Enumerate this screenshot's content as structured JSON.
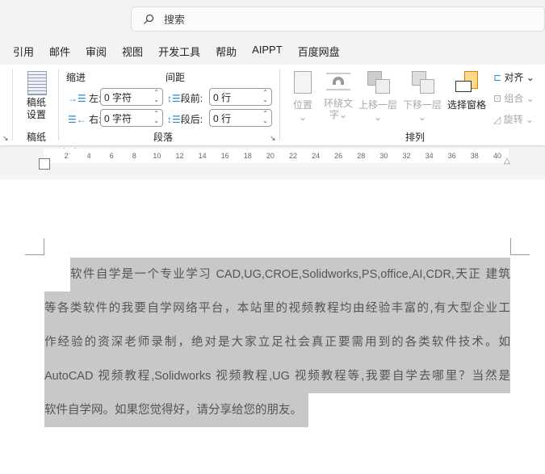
{
  "search": {
    "placeholder": "搜索"
  },
  "menu": [
    "引用",
    "邮件",
    "审阅",
    "视图",
    "开发工具",
    "帮助",
    "AIPPT",
    "百度网盘"
  ],
  "ribbon": {
    "gaozhi": {
      "button": [
        "稿纸",
        "设置"
      ],
      "group": "稿纸"
    },
    "paragraph": {
      "indent": "缩进",
      "spacing": "间距",
      "left": "左:",
      "right": "右:",
      "before": "段前:",
      "after": "段后:",
      "left_value": "0 字符",
      "right_value": "0 字符",
      "before_value": "0 行",
      "after_value": "0 行",
      "group": "段落"
    },
    "arrange": {
      "position": "位置",
      "wrap": [
        "环绕文",
        "字"
      ],
      "forward": "上移一层",
      "backward": "下移一层",
      "selection_pane": "选择窗格",
      "align": "对齐",
      "group_btn": "组合",
      "rotate": "旋转",
      "group": "排列"
    }
  },
  "ruler": [
    "2",
    "4",
    "6",
    "8",
    "10",
    "12",
    "14",
    "16",
    "18",
    "20",
    "22",
    "24",
    "26",
    "28",
    "30",
    "32",
    "34",
    "36",
    "38",
    "40"
  ],
  "document": {
    "lines": [
      "软件自学是一个专业学习 CAD,UG,CROE,Solidworks,PS,office,AI,CDR,天正 建筑",
      "等各类软件的我要自学网络平台，本站里的视频教程均由经验丰富的,有大型企业工",
      "作经验的资深老师录制，绝对是大家立足社会真正要需用到的各类软件技术。如",
      "AutoCAD 视频教程,Solidworks 视频教程,UG 视频教程等,我要自学去哪里？当然是",
      "软件自学网。如果您觉得好，请分享给您的朋友。"
    ]
  },
  "colors": {
    "selection": "#c8c8c8",
    "accent": "#2b88d8"
  }
}
